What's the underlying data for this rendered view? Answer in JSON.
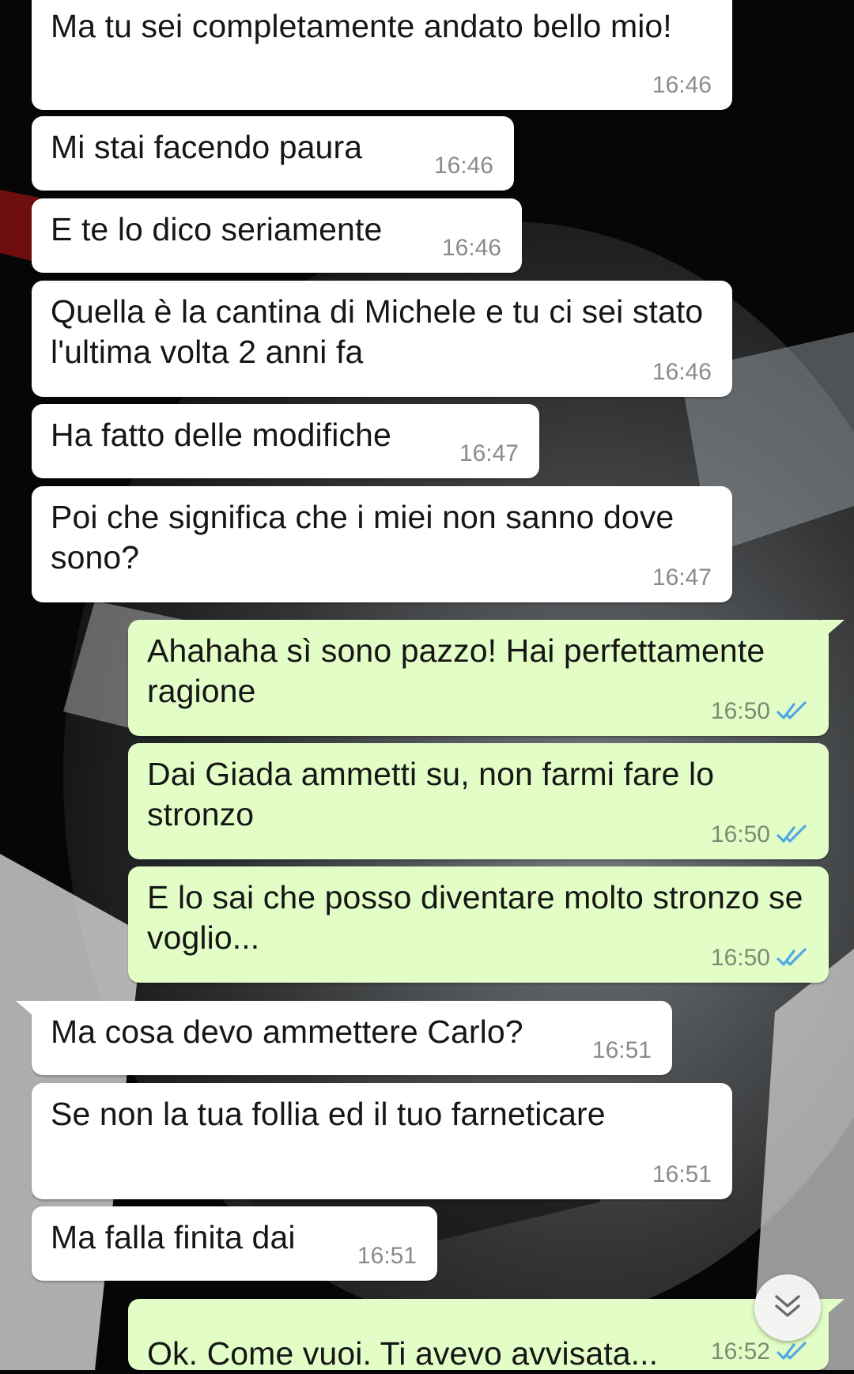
{
  "chat": {
    "messages": [
      {
        "direction": "in",
        "text": "Ma tu sei completamente andato bello mio!",
        "time": "16:46"
      },
      {
        "direction": "in",
        "text": "Mi stai facendo paura",
        "time": "16:46"
      },
      {
        "direction": "in",
        "text": "E te lo dico seriamente",
        "time": "16:46"
      },
      {
        "direction": "in",
        "text": "Quella è la cantina di Michele e tu ci sei stato l'ultima volta 2 anni fa",
        "time": "16:46"
      },
      {
        "direction": "in",
        "text": "Ha fatto delle modifiche",
        "time": "16:47"
      },
      {
        "direction": "in",
        "text": "Poi che significa che i miei non sanno dove sono?",
        "time": "16:47"
      },
      {
        "direction": "out",
        "text": "Ahahaha sì sono pazzo! Hai perfettamente ragione",
        "time": "16:50",
        "status": "read"
      },
      {
        "direction": "out",
        "text": "Dai Giada ammetti su, non farmi fare lo stronzo",
        "time": "16:50",
        "status": "read"
      },
      {
        "direction": "out",
        "text": "E lo sai che posso diventare molto stronzo se voglio...",
        "time": "16:50",
        "status": "read"
      },
      {
        "direction": "in",
        "text": "Ma cosa devo ammettere Carlo?",
        "time": "16:51"
      },
      {
        "direction": "in",
        "text": "Se non la tua follia ed il tuo farneticare",
        "time": "16:51"
      },
      {
        "direction": "in",
        "text": "Ma falla finita dai",
        "time": "16:51"
      },
      {
        "direction": "out",
        "text": "Ok. Come vuoi. Ti avevo avvisata...",
        "time": "16:52",
        "status": "read"
      }
    ]
  },
  "icons": {
    "read_ticks": "double-check-icon",
    "scroll_down": "chevron-double-down-icon"
  },
  "colors": {
    "incoming_bubble": "#ffffff",
    "outgoing_bubble": "#e2fec6",
    "read_ticks": "#4fa7e6",
    "timestamp": "#8b8b8b"
  }
}
